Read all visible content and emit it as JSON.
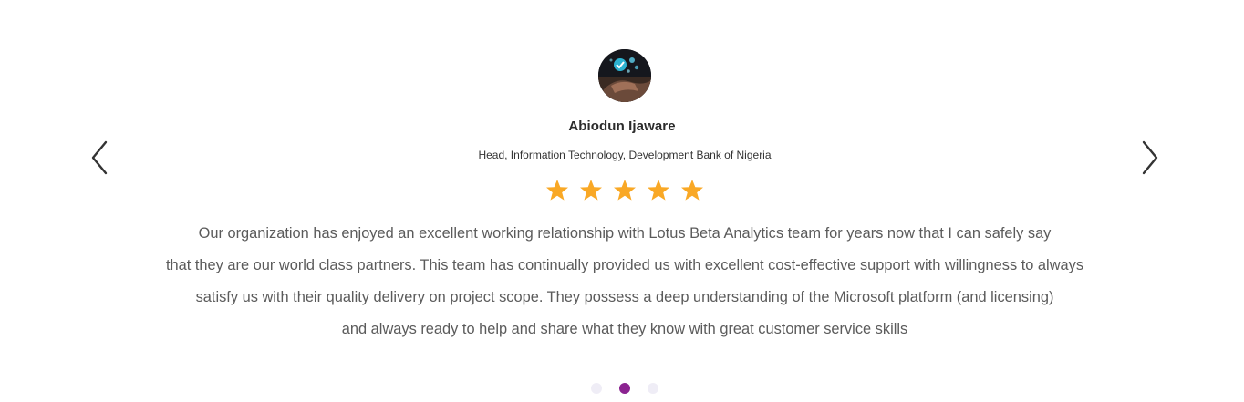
{
  "testimonial": {
    "name": "Abiodun Ijaware",
    "role": "Head, Information Technology, Development Bank of Nigeria",
    "rating": 5,
    "rating_max": 5,
    "quote_lines": [
      "Our organization has enjoyed an excellent working relationship with Lotus Beta Analytics team for years now that I can safely say",
      "that they are our world class partners. This team has continually provided us with excellent cost-effective support with willingness to always",
      "satisfy us with their quality delivery on project scope. They possess a deep understanding of the Microsoft platform (and licensing)",
      "and always ready to help and share what they know with great customer service skills"
    ]
  },
  "navigation": {
    "prev_icon": "chevron-left-icon",
    "next_icon": "chevron-right-icon",
    "slide_count": 3,
    "active_slide": 2
  },
  "colors": {
    "star": "#f9a825",
    "active_dot": "#8b2390",
    "inactive_dot": "#efedf6",
    "name_text": "#2b2b2b",
    "body_text": "#5b5b5b",
    "arrow": "#333333"
  }
}
